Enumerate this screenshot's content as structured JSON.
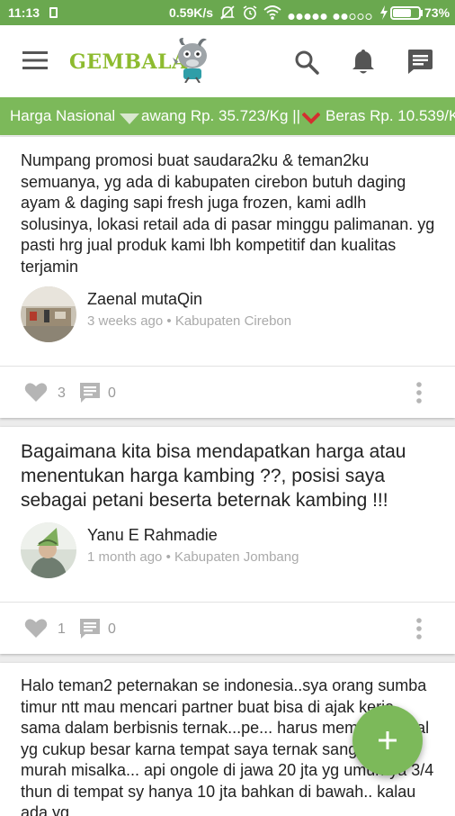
{
  "status_bar": {
    "time": "11:13",
    "speed": "0.59K/s",
    "battery": "73%",
    "battery_level": 0.73
  },
  "app_bar": {
    "logo_text": "GEMBALA"
  },
  "ticker": {
    "label": "Harga Nasional",
    "text_1": "awang Rp. 35.723/Kg ||",
    "text_2": "Beras Rp. 10.539/K"
  },
  "posts": [
    {
      "text": "Numpang promosi buat saudara2ku & teman2ku semuanya, yg ada di kabupaten cirebon butuh daging ayam & daging sapi fresh juga frozen, kami adlh solusinya, lokasi retail ada di pasar minggu palimanan. yg pasti hrg jual produk kami lbh kompetitif dan kualitas terjamin",
      "author": "Zaenal mutaQin",
      "time_ago": "3 weeks ago",
      "location": "Kabupaten Cirebon",
      "likes": "3",
      "comments": "0"
    },
    {
      "text": "Bagaimana kita bisa mendapatkan harga atau menentukan harga kambing ??, posisi saya sebagai petani beserta beternak kambing !!!",
      "author": "Yanu E Rahmadie",
      "time_ago": "1 month ago",
      "location": "Kabupaten Jombang",
      "likes": "1",
      "comments": "0"
    },
    {
      "text": "Halo teman2 peternakan se indonesia..sya orang sumba timur ntt mau mencari partner buat bisa di ajak kerja sama dalam berbisnis ternak...pe... harus memiliki modal yg cukup besar karna tempat saya ternak sangatlah murah misalka... api ongole di jawa 20 jta yg umurnya 3/4 thun di tempat sy hanya 10 jta bahkan di bawah.. kalau ada yg"
    }
  ],
  "colors": {
    "primary": "#7cb95a",
    "status_bar": "#6aa84f",
    "ticker_arrow_down": "#d32f2f",
    "icon_gray": "#555555",
    "action_gray": "#b5b5b5"
  }
}
